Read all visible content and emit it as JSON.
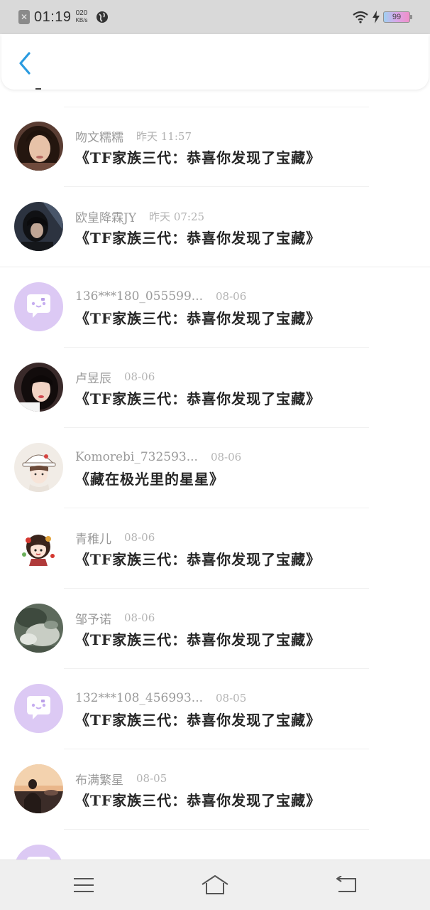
{
  "status_bar": {
    "close_glyph": "✕",
    "time": "01:19",
    "net_speed_value": "020",
    "net_speed_unit": "KB/s",
    "battery": "99",
    "icons": [
      "close-notification-icon",
      "globe-icon",
      "wifi-icon",
      "charging-icon",
      "battery-icon"
    ]
  },
  "header": {
    "back_icon": "chevron-left-icon",
    "accent_color": "#2a9be0"
  },
  "items": [
    {
      "name": "吻文糯糯",
      "time": "昨天 11:57",
      "title": "《TF家族三代：恭喜你发现了宝藏》",
      "avatar": "photo-girl"
    },
    {
      "name": "欧皇降霖JY",
      "time": "昨天 07:25",
      "title": "《TF家族三代：恭喜你发现了宝藏》",
      "avatar": "photo-dark"
    },
    {
      "name": "136***180_055599...",
      "time": "08-06",
      "title": "《TF家族三代：恭喜你发现了宝藏》",
      "avatar": "default-chat"
    },
    {
      "name": "卢昱辰",
      "time": "08-06",
      "title": "《TF家族三代：恭喜你发现了宝藏》",
      "avatar": "photo-girl-2"
    },
    {
      "name": "Komorebi_732593...",
      "time": "08-06",
      "title": "《藏在极光里的星星》",
      "avatar": "illustration-hat"
    },
    {
      "name": "青稚儿",
      "time": "08-06",
      "title": "《TF家族三代：恭喜你发现了宝藏》",
      "avatar": "cartoon-girl"
    },
    {
      "name": "邹予诺",
      "time": "08-06",
      "title": "《TF家族三代：恭喜你发现了宝藏》",
      "avatar": "photo-scene"
    },
    {
      "name": "132***108_456993...",
      "time": "08-05",
      "title": "《TF家族三代：恭喜你发现了宝藏》",
      "avatar": "default-chat"
    },
    {
      "name": "布满繁星",
      "time": "08-05",
      "title": "《TF家族三代：恭喜你发现了宝藏》",
      "avatar": "photo-sunset"
    },
    {
      "name": "",
      "time": "",
      "title": "",
      "avatar": "default-chat"
    }
  ],
  "bottom_nav": {
    "icons": [
      "menu-icon",
      "home-icon",
      "back-icon"
    ]
  }
}
